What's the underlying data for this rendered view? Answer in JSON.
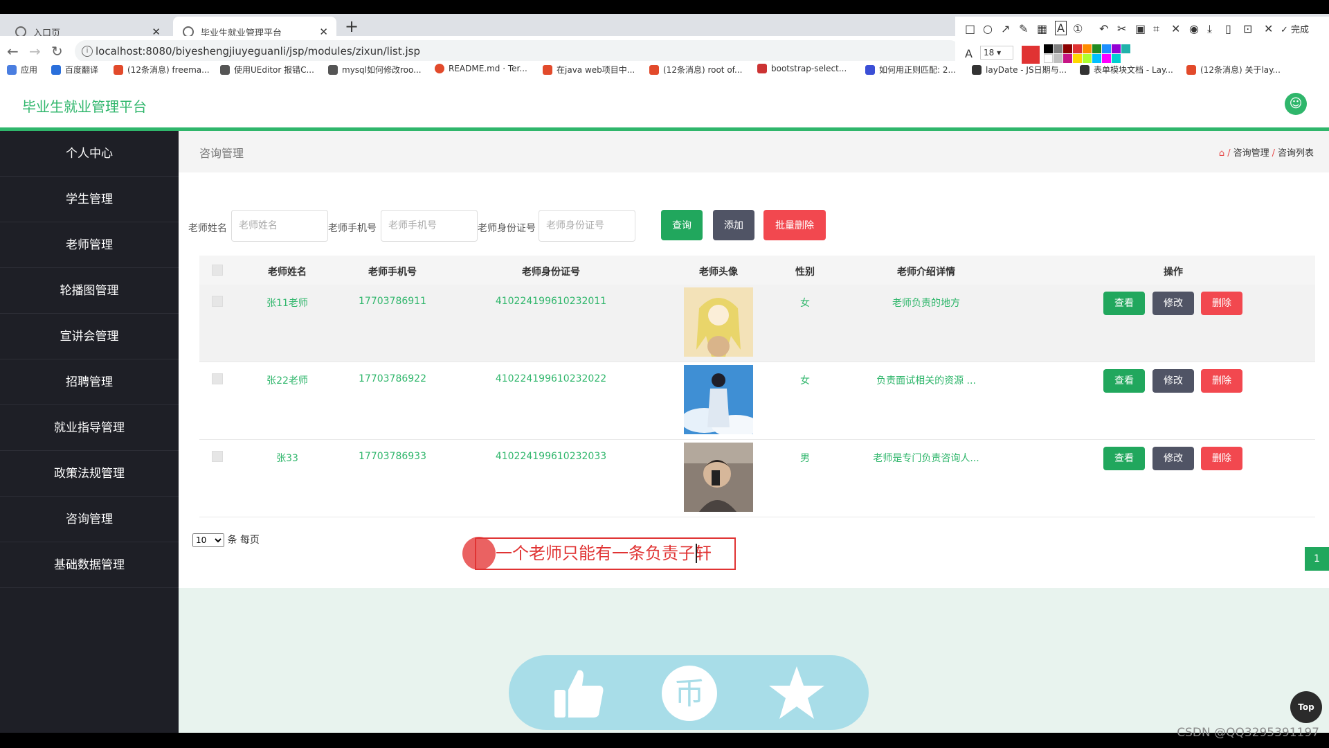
{
  "browser": {
    "tabs": [
      {
        "label": "入口页",
        "active": false
      },
      {
        "label": "毕业生就业管理平台",
        "active": true
      }
    ],
    "url": "localhost:8080/biyeshengjiuyeguanli/jsp/modules/zixun/list.jsp",
    "bookmarks": [
      "应用",
      "百度翻译",
      "(12条消息) freema...",
      "使用UEditor 报错C...",
      "mysql如何修改roo...",
      "README.md · Ter...",
      "在java web项目中...",
      "(12条消息) root of...",
      "bootstrap-select...",
      "如何用正则匹配: 2...",
      "layDate - JS日期与...",
      "表单模块文档 - Lay...",
      "(12条消息) 关于lay..."
    ]
  },
  "snaptool": {
    "done_label": "完成",
    "font_size": "18",
    "text_tool_label": "A",
    "colors": [
      "#e03333",
      "#000000",
      "#808080",
      "#8b0000",
      "#e03333",
      "#ff8c00",
      "#228b22",
      "#1e90ff",
      "#9400d3",
      "#20b2aa",
      "#ffffff",
      "#c0c0c0",
      "#c71585",
      "#ffd700",
      "#adff2f",
      "#00bfff",
      "#ff00ff",
      "#00ced1"
    ]
  },
  "app": {
    "brand": "毕业生就业管理平台",
    "accent": "#2fb66b",
    "sidebar": [
      "个人中心",
      "学生管理",
      "老师管理",
      "轮播图管理",
      "宣讲会管理",
      "招聘管理",
      "就业指导管理",
      "政策法规管理",
      "咨询管理",
      "基础数据管理"
    ]
  },
  "page": {
    "title": "咨询管理",
    "breadcrumbs": [
      "咨询管理",
      "咨询列表"
    ],
    "filters": [
      {
        "label": "老师姓名",
        "placeholder": "老师姓名"
      },
      {
        "label": "老师手机号",
        "placeholder": "老师手机号"
      },
      {
        "label": "老师身份证号",
        "placeholder": "老师身份证号"
      }
    ],
    "buttons": {
      "search": "查询",
      "add": "添加",
      "batch_delete": "批量删除"
    },
    "columns": [
      "老师姓名",
      "老师手机号",
      "老师身份证号",
      "老师头像",
      "性别",
      "老师介绍详情",
      "操作"
    ],
    "rows": [
      {
        "name": "张11老师",
        "phone": "17703786911",
        "id_card": "410224199610232011",
        "gender": "女",
        "intro": "老师负责的地方"
      },
      {
        "name": "张22老师",
        "phone": "17703786922",
        "id_card": "410224199610232022",
        "gender": "女",
        "intro": "负责面试相关的资源 ..."
      },
      {
        "name": "张33",
        "phone": "17703786933",
        "id_card": "410224199610232033",
        "gender": "男",
        "intro": "老师是专门负责咨询人..."
      }
    ],
    "row_actions": {
      "view": "查看",
      "edit": "修改",
      "delete": "删除"
    },
    "pager": {
      "page_size": "10",
      "page_size_suffix": "条 每页",
      "current_page": "1"
    }
  },
  "annotation_text": "一个老师只能有一条负责子轩",
  "top_button": "Top",
  "watermark": "CSDN @QQ3295391197"
}
